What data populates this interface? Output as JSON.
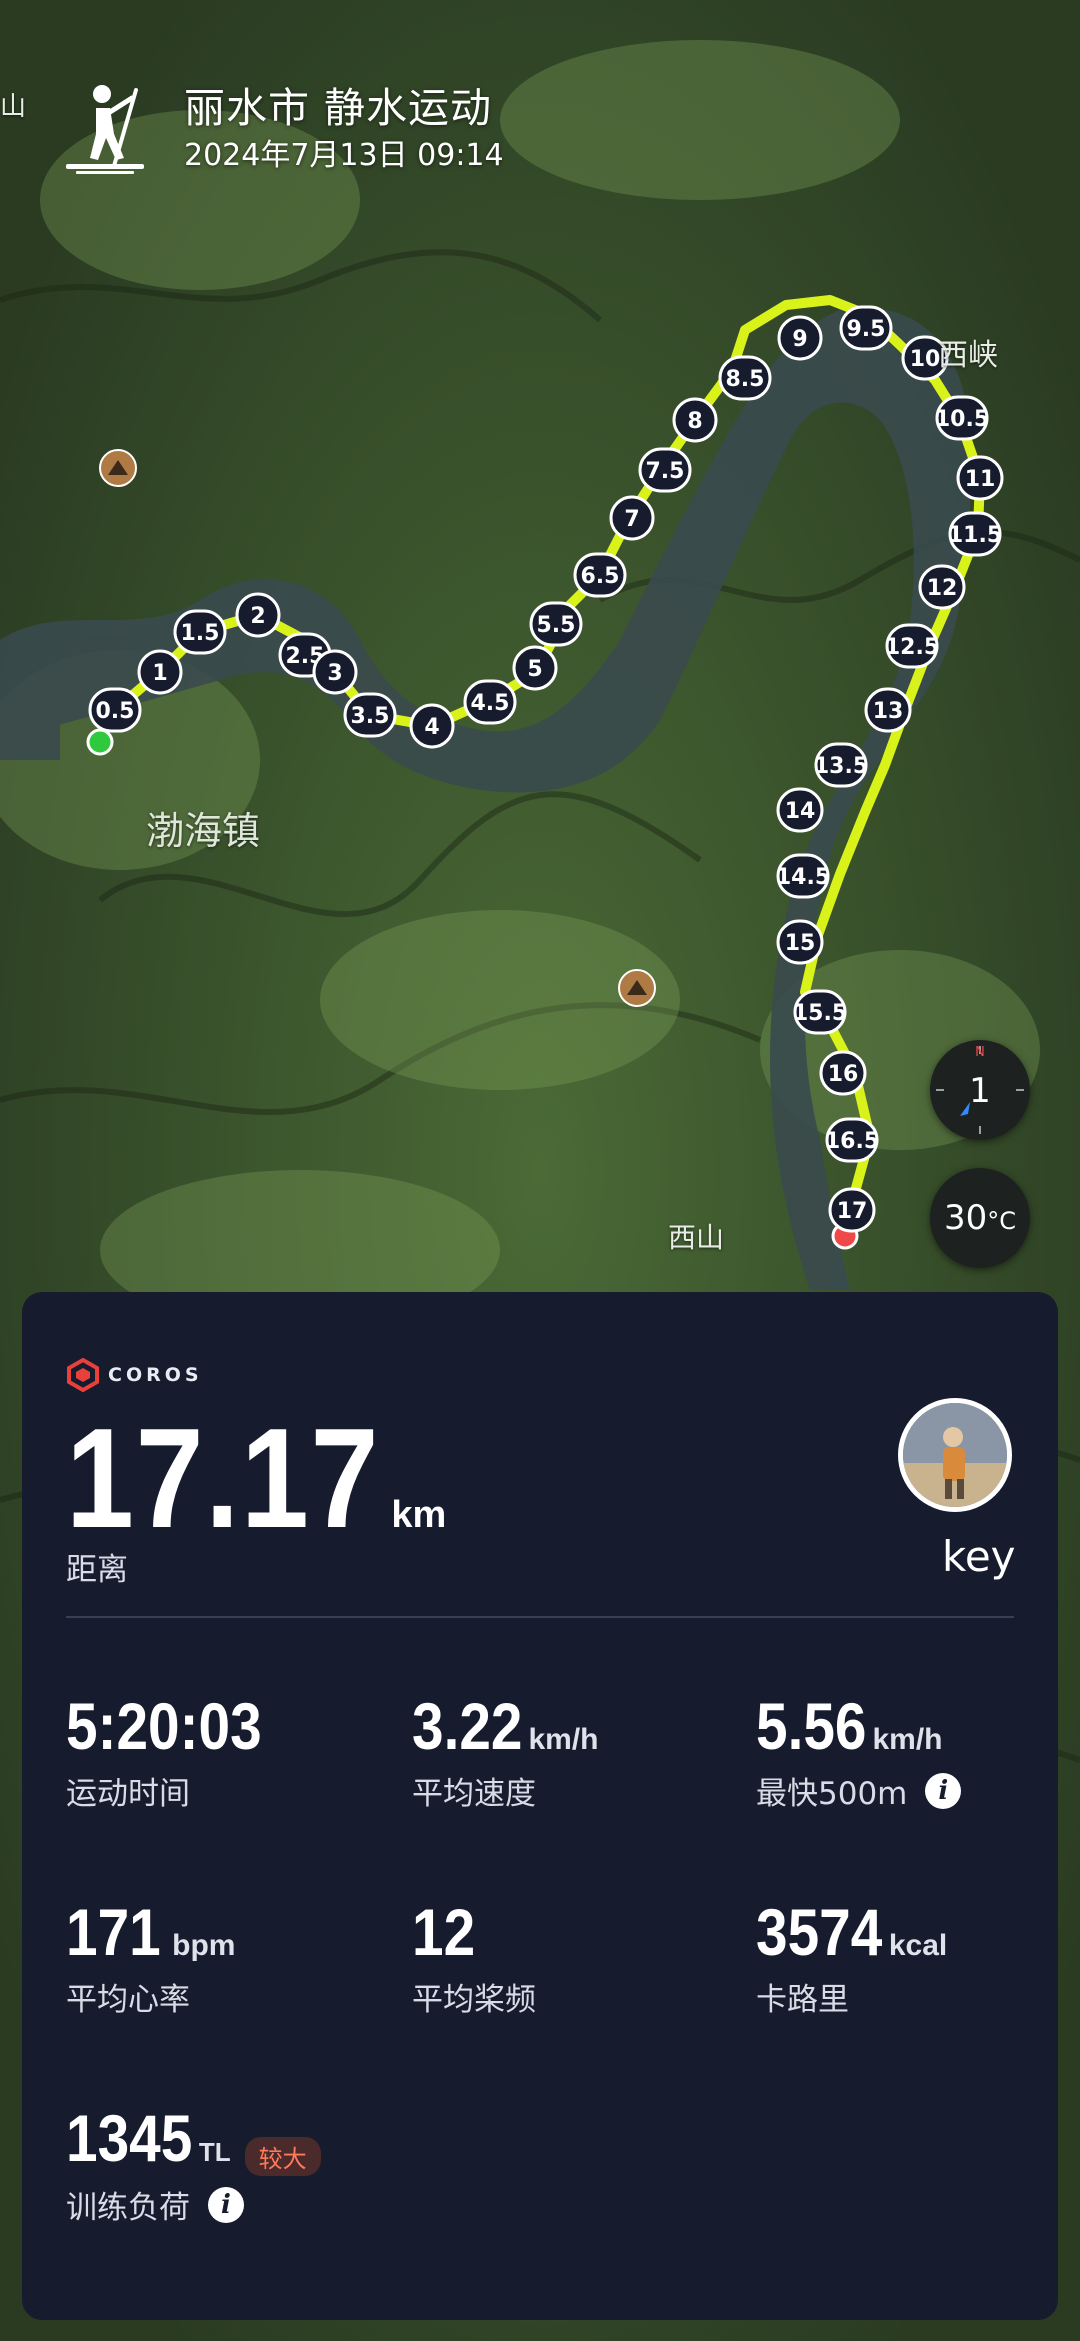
{
  "header": {
    "title": "丽水市 静水运动",
    "date": "2024年7月13日 09:14",
    "sport_icon": "paddleboard-icon"
  },
  "map": {
    "place_labels": [
      "渤海镇",
      "西山",
      "西峡",
      "山"
    ],
    "km_markers": [
      "0.5",
      "1",
      "1.5",
      "2",
      "2.5",
      "3",
      "3.5",
      "4",
      "4.5",
      "5",
      "5.5",
      "6.5",
      "7",
      "7.5",
      "8",
      "8.5",
      "9",
      "9.5",
      "10",
      "10.5",
      "11",
      "11.5",
      "12",
      "12.5",
      "13",
      "13.5",
      "14",
      "14.5",
      "15",
      "15.5",
      "16",
      "16.5",
      "17"
    ],
    "compass": {
      "value": "1",
      "north_label": "N"
    },
    "temperature": {
      "value": "30",
      "unit": "°C"
    },
    "colors": {
      "route": "#d9f21a",
      "start": "#2ec93c",
      "end": "#f04848",
      "marker_bg": "#161b2e"
    }
  },
  "card": {
    "brand": "COROS",
    "distance": {
      "value": "17.17",
      "unit": "km",
      "label": "距离"
    },
    "user": {
      "name": "key"
    },
    "stats": [
      {
        "value": "5:20:03",
        "unit": "",
        "label": "运动时间"
      },
      {
        "value": "3.22",
        "unit": "km/h",
        "label": "平均速度"
      },
      {
        "value": "5.56",
        "unit": "km/h",
        "label": "最快500m",
        "info": true
      },
      {
        "value": "171",
        "unit": "bpm",
        "label": "平均心率"
      },
      {
        "value": "12",
        "unit": "",
        "label": "平均桨频"
      },
      {
        "value": "3574",
        "unit": "kcal",
        "label": "卡路里"
      },
      {
        "value": "1345",
        "unit": "TL",
        "label": "训练负荷",
        "badge": "较大",
        "info": true
      }
    ]
  }
}
